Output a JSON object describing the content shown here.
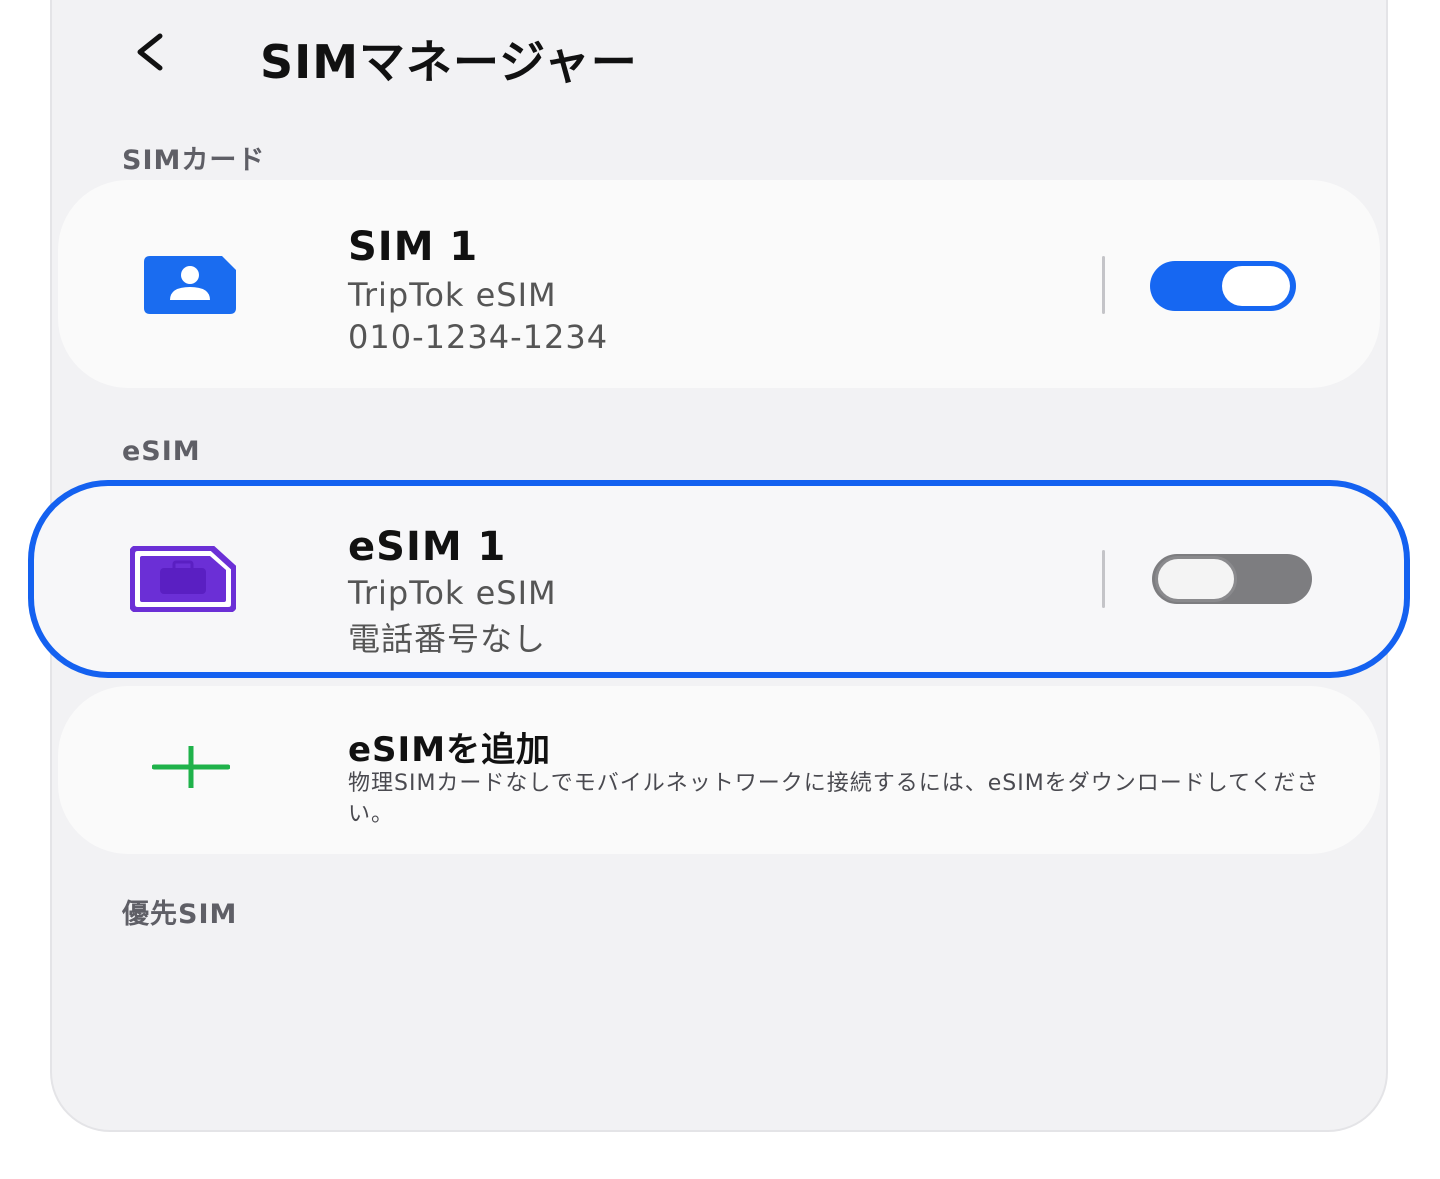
{
  "header": {
    "title": "SIMマネージャー",
    "back_icon": "chevron-left-icon"
  },
  "sections": {
    "sim_card": "SIMカード",
    "esim": "eSIM",
    "preferred": "優先SIM"
  },
  "sim1": {
    "title": "SIM 1",
    "carrier": "TripTok eSIM",
    "number": "010-1234-1234",
    "icon": "sim-card-person-icon",
    "toggle": "on"
  },
  "esim1": {
    "title": "eSIM 1",
    "carrier": "TripTok eSIM",
    "number": "電話番号なし",
    "icon": "esim-briefcase-icon",
    "toggle": "off"
  },
  "add_esim": {
    "title": "eSIMを追加",
    "description": "物理SIMカードなしでモバイルネットワークに接続するには、eSIMをダウンロードしてください。",
    "icon": "plus-icon"
  },
  "colors": {
    "accent_blue": "#1461f0",
    "sim_icon_blue": "#1a6cf0",
    "esim_icon_purple": "#6b2fd6",
    "plus_green": "#1fb24a"
  }
}
